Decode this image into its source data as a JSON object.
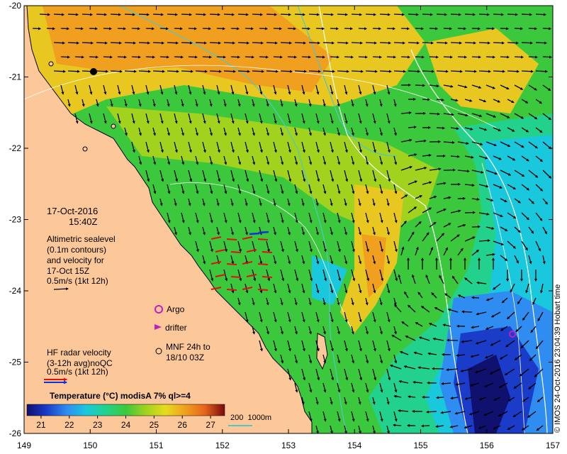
{
  "map": {
    "lon_ticks": [
      "149",
      "150",
      "151",
      "152",
      "153",
      "154",
      "155",
      "156",
      "157"
    ],
    "lat_ticks": [
      "-20",
      "-21",
      "-22",
      "-23",
      "-24",
      "-25",
      "-26"
    ],
    "lon_range": [
      149,
      157
    ],
    "lat_range": [
      -26,
      -20
    ]
  },
  "annotations": {
    "date": "17-Oct-2016",
    "time": "15:40Z",
    "altimetry_lines": [
      "Altimetric sealevel",
      "(0.1m contours)",
      "and velocity for",
      "17-Oct 15Z"
    ],
    "alt_scale": "0.5m/s (1kt 12h)",
    "argo": "Argo",
    "drifter": "drifter",
    "mnf_lines": [
      "MNF 24h to",
      "18/10 03Z"
    ],
    "hf_lines": [
      "HF radar velocity",
      "(3-12h avg)noQC",
      "0.5m/s (1kt 12h)"
    ]
  },
  "colorbar": {
    "title": "Temperature (°C) modisA 7% ql>=4",
    "tick_labels": [
      "21",
      "22",
      "23",
      "24",
      "25",
      "26",
      "27"
    ],
    "range": [
      20.5,
      27.5
    ],
    "colors": [
      "#10106e",
      "#1a3cc8",
      "#2f8cf0",
      "#19c8dc",
      "#22d28c",
      "#3cc83c",
      "#a0d21e",
      "#e6dc1e",
      "#f0a01e",
      "#e6641e",
      "#c8281e",
      "#780a0a"
    ]
  },
  "bathymetry_legend": {
    "label": "200  1000m",
    "colors": {
      "c200": "#50c8c8",
      "c1000": "#ffffff"
    }
  },
  "credit": "© IMOS 24-Oct-2016 23:04:39 Hobart time",
  "colors": {
    "land": "#fcc89a",
    "hf_radar": "#e01010",
    "hf_radar_alt": "#1030e0",
    "argo": "#c020c0",
    "drifter": "#c020c0"
  }
}
